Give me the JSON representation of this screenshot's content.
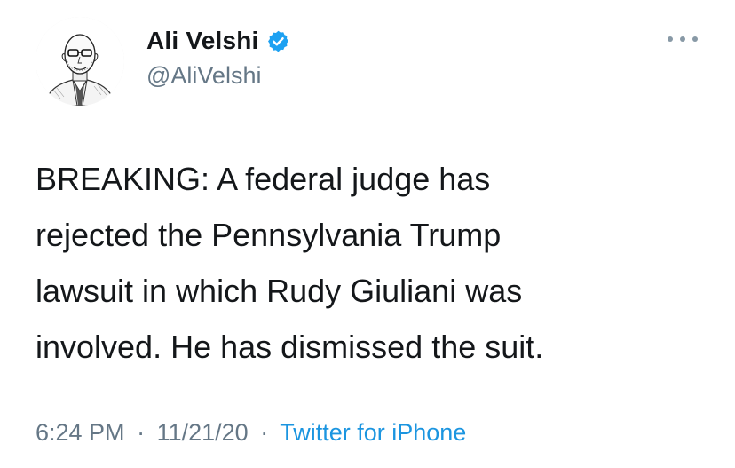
{
  "tweet": {
    "author": {
      "display_name": "Ali Velshi",
      "handle": "@AliVelshi",
      "verified": true,
      "avatar": "sketch-portrait"
    },
    "text": "BREAKING: A federal judge has\nrejected the Pennsylvania Trump\nlawsuit in which Rudy Giuliani was\ninvolved. He has dismissed the suit.",
    "time": "6:24 PM",
    "date": "11/21/20",
    "separator": "·",
    "source": "Twitter for iPhone"
  },
  "icons": {
    "verified": "verified-badge-icon",
    "more": "more-options-icon"
  },
  "colors": {
    "primary_text": "#14171a",
    "secondary_text": "#657786",
    "link": "#1b95e0",
    "verified": "#1da1f2"
  }
}
